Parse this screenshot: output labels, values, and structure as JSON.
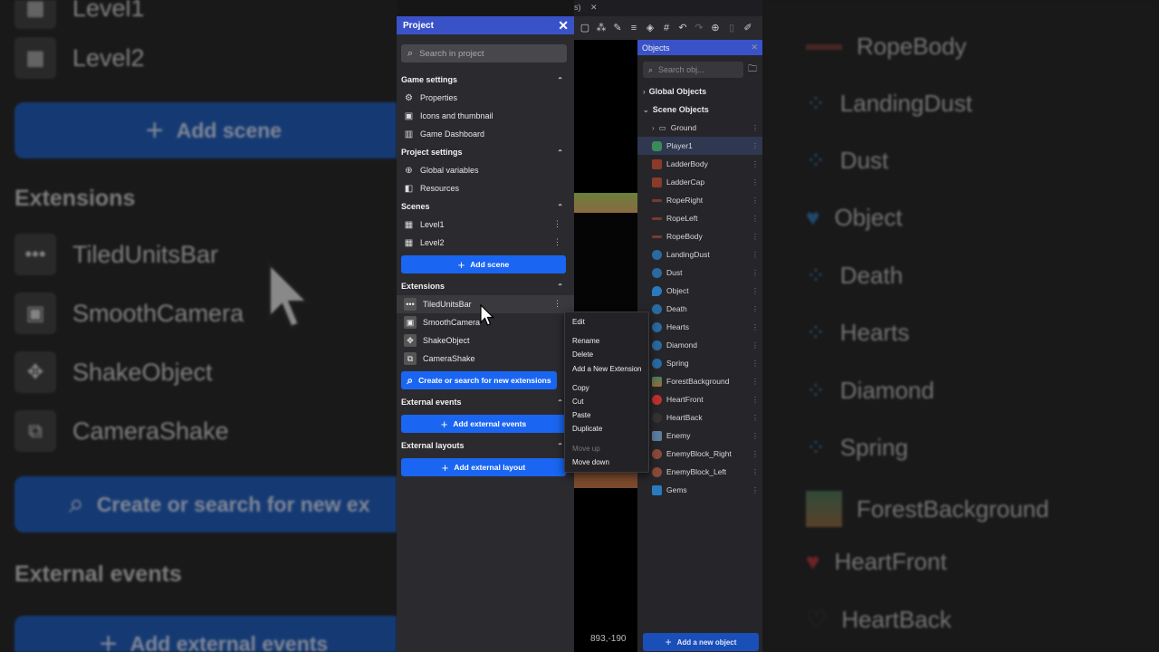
{
  "background_left": {
    "rows_top": [
      "Level1",
      "Level2"
    ],
    "add_scene": "Add scene",
    "extensions_heading": "Extensions",
    "extensions": [
      "TiledUnitsBar",
      "SmoothCamera",
      "ShakeObject",
      "CameraShake"
    ],
    "search_ext": "Create or search for new ex",
    "external_events_heading": "External events",
    "add_external": "Add external events"
  },
  "background_right": {
    "objects": [
      "RopeBody",
      "LandingDust",
      "Dust",
      "Object",
      "Death",
      "Hearts",
      "Diamond",
      "Spring",
      "ForestBackground",
      "HeartFront",
      "HeartBack"
    ]
  },
  "project": {
    "title": "Project",
    "search_placeholder": "Search in project",
    "game_settings": {
      "heading": "Game settings",
      "items": [
        "Properties",
        "Icons and thumbnail",
        "Game Dashboard"
      ]
    },
    "project_settings": {
      "heading": "Project settings",
      "items": [
        "Global variables",
        "Resources"
      ]
    },
    "scenes": {
      "heading": "Scenes",
      "items": [
        "Level1",
        "Level2"
      ],
      "add_button": "Add scene"
    },
    "extensions": {
      "heading": "Extensions",
      "items": [
        "TiledUnitsBar",
        "SmoothCamera",
        "ShakeObject",
        "CameraShake"
      ],
      "search_button": "Create or search for new extensions"
    },
    "external_events": {
      "heading": "External events",
      "add_button": "Add external events"
    },
    "external_layouts": {
      "heading": "External layouts",
      "add_button": "Add external layout"
    }
  },
  "context_menu": {
    "items": [
      "Edit",
      "Rename",
      "Delete",
      "Add a New Extension",
      "Copy",
      "Cut",
      "Paste",
      "Duplicate",
      "Move up",
      "Move down"
    ]
  },
  "canvas": {
    "coordinates": "893,-190",
    "tab_fragment": "s)"
  },
  "objects_panel": {
    "title": "Objects",
    "search_placeholder": "Search obj...",
    "global_group": "Global Objects",
    "scene_group": "Scene Objects",
    "folder": "Ground",
    "items": [
      "Player1",
      "LadderBody",
      "LadderCap",
      "RopeRight",
      "RopeLeft",
      "RopeBody",
      "LandingDust",
      "Dust",
      "Object",
      "Death",
      "Hearts",
      "Diamond",
      "Spring",
      "ForestBackground",
      "HeartFront",
      "HeartBack",
      "Enemy",
      "EnemyBlock_Right",
      "EnemyBlock_Left",
      "Gems"
    ],
    "selected": "Player1",
    "add_button": "Add a new object"
  },
  "colors": {
    "accent_blue": "#1a66f2",
    "header_blue": "#3a52c8",
    "panel_bg": "#2b2b2f"
  }
}
